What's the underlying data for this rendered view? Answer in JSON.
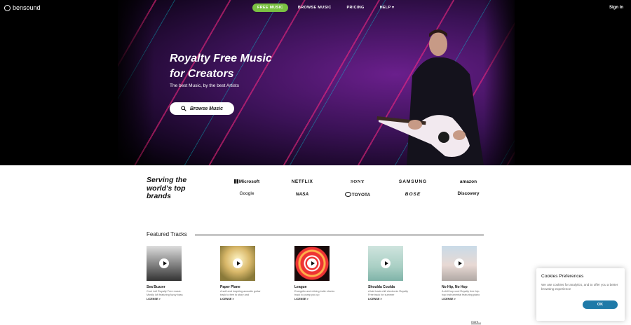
{
  "header": {
    "logo_text": "bensound",
    "nav": [
      {
        "label": "FREE MUSIC",
        "active": true
      },
      {
        "label": "BROWSE MUSIC"
      },
      {
        "label": "PRICING"
      },
      {
        "label": "HELP"
      }
    ],
    "signin_label": "Sign In",
    "accent_color": "#7ac142"
  },
  "hero": {
    "title_line1": "Royalty Free Music",
    "title_line2": "for Creators",
    "subtitle": "The best Music, by the best Artists",
    "browse_label": "Browse Music"
  },
  "brands": {
    "title_line1": "Serving the",
    "title_line2": "world's top",
    "title_line3": "brands",
    "names": [
      "Microsoft",
      "NETFLIX",
      "SONY",
      "SAMSUNG",
      "amazon",
      "Google",
      "NASA",
      "TOYOTA",
      "BOSE",
      "Discovery"
    ]
  },
  "featured": {
    "label": "Featured Tracks",
    "tracks": [
      {
        "title": "Sea Buzzer",
        "desc": "Cool Lofi Royalty Free music. Mostly lofi featuring fuzzy bass",
        "license": "LICENSE >"
      },
      {
        "title": "Paper Plane",
        "desc": "A soft and inspiring acoustic guitar track to free to story and",
        "license": "LICENSE >"
      },
      {
        "title": "League",
        "desc": "Energetic and driving indie electro track to pump you up",
        "license": "LICENSE >"
      },
      {
        "title": "Shoulda Coulda",
        "desc": "A laid back chill electronic Royalty Free track for summer",
        "license": "LICENSE >"
      },
      {
        "title": "No Hip, No Hop",
        "desc": "A chill hop cool Royalty free hip-hop instrumental featuring piano",
        "license": "LICENSE >"
      }
    ],
    "more_label": "more..."
  },
  "cookie": {
    "title": "Cookies Preferences",
    "text": "We use cookies for analytics, and to offer you a better browsing experience",
    "ok_label": "OK",
    "button_color": "#1f7aa8"
  }
}
